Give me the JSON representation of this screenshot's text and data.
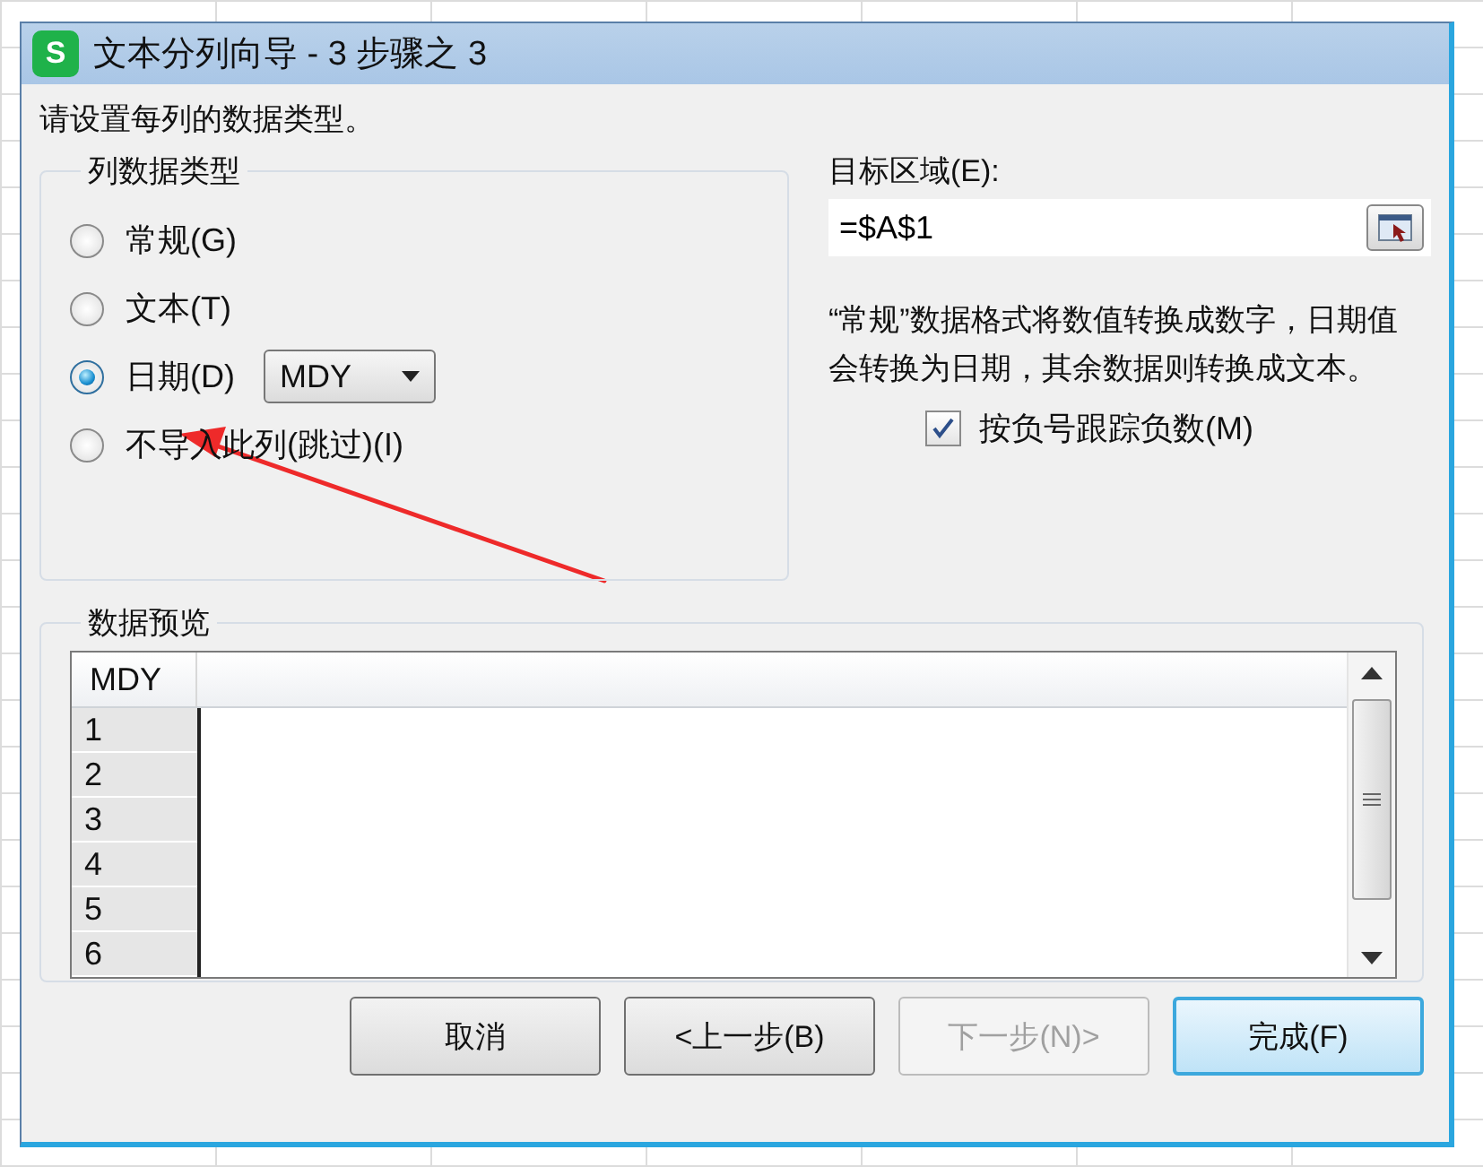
{
  "window": {
    "title": "文本分列向导 - 3 步骤之 3",
    "app_icon": "S"
  },
  "instruction": "请设置每列的数据类型。",
  "column_type": {
    "title": "列数据类型",
    "options": [
      {
        "label": "常规(G)",
        "selected": false
      },
      {
        "label": "文本(T)",
        "selected": false
      },
      {
        "label": "日期(D)",
        "selected": true,
        "dropdown": "MDY"
      },
      {
        "label": "不导入此列(跳过)(I)",
        "selected": false
      }
    ]
  },
  "destination": {
    "label": "目标区域(E):",
    "value": "=$A$1"
  },
  "description": "“常规”数据格式将数值转换成数字，日期值会转换为日期，其余数据则转换成文本。",
  "negative_tracking": {
    "label": "按负号跟踪负数(M)",
    "checked": true
  },
  "preview": {
    "title": "数据预览",
    "columns": [
      "MDY"
    ],
    "row_numbers": [
      "1",
      "2",
      "3",
      "4",
      "5",
      "6"
    ]
  },
  "buttons": [
    {
      "label": "取消",
      "disabled": false,
      "default": false
    },
    {
      "label": "<上一步(B)",
      "disabled": false,
      "default": false
    },
    {
      "label": "下一步(N)>",
      "disabled": true,
      "default": false
    },
    {
      "label": "完成(F)",
      "disabled": false,
      "default": true
    }
  ]
}
